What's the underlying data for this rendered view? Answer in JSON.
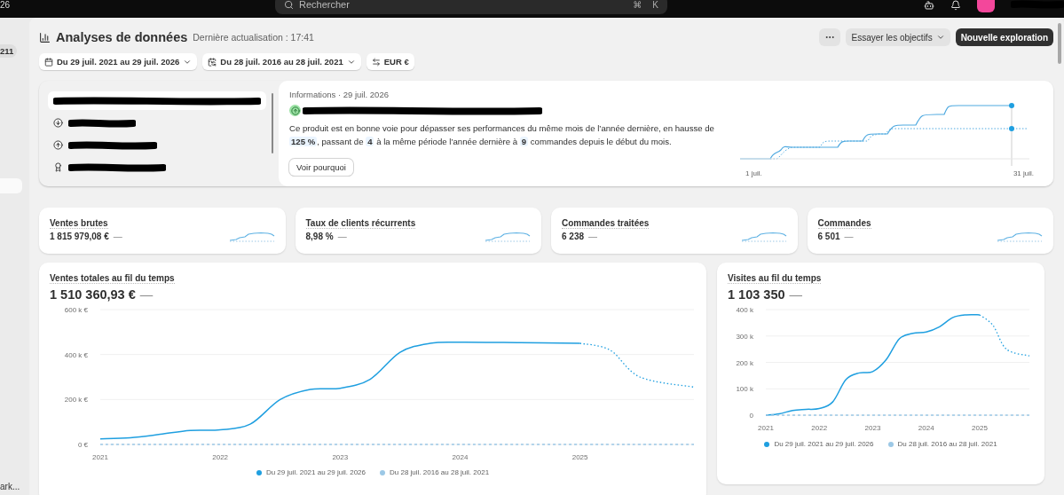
{
  "top_bar": {
    "corner_text": "26",
    "search": {
      "placeholder": "Rechercher",
      "shortcut": [
        "⌘",
        "K"
      ]
    }
  },
  "sidebar": {
    "badge": "211",
    "items": [
      {
        "selected": true
      }
    ],
    "footer_text": "ark..."
  },
  "header": {
    "title": "Analyses de données",
    "subtitle": "Dernière actualisation : 17:41",
    "actions": [
      {
        "kind": "more"
      },
      {
        "kind": "dropdown",
        "label": "Essayer les objectifs"
      },
      {
        "kind": "primary",
        "label": "Nouvelle exploration"
      }
    ]
  },
  "filters": [
    {
      "kind": "date",
      "label": "Du 29 juil. 2021 au 29 juil. 2026"
    },
    {
      "kind": "compare",
      "label": "Du 28 juil. 2016 au 28 juil. 2021"
    },
    {
      "kind": "currency",
      "label": "EUR €"
    }
  ],
  "insights": {
    "items": [
      {
        "kind": "covered",
        "selected": true
      },
      {
        "kind": "down",
        "selected": false
      },
      {
        "kind": "up",
        "selected": false
      },
      {
        "kind": "award",
        "selected": false
      }
    ],
    "detail": {
      "heading": "Informations · 29 juil. 2026",
      "text": "Ce produit est en bonne voie pour dépasser ses performances du même mois de l’année dernière, en hausse de **125 %**, passant de **4** à la même période l’année dernière à **9** commandes depuis le début du mois.",
      "button": "Voir pourquoi",
      "chart_labels": [
        "1 juil.",
        "31 juil."
      ]
    }
  },
  "kpis": [
    {
      "label": "Ventes brutes",
      "value": "1 815 979,08 €",
      "change": "—"
    },
    {
      "label": "Taux de clients récurrents",
      "value": "8,98 %",
      "change": "—"
    },
    {
      "label": "Commandes traitées",
      "value": "6 238",
      "change": "—"
    },
    {
      "label": "Commandes",
      "value": "6 501",
      "change": "—"
    }
  ],
  "charts": [
    {
      "title": "Ventes totales au fil du temps",
      "value": "1 510 360,93 €",
      "change": "—",
      "chart_data": {
        "type": "line",
        "x": [
          2021,
          2021.25,
          2021.5,
          2021.75,
          2022,
          2022.25,
          2022.5,
          2022.75,
          2023,
          2023.25,
          2023.5,
          2023.75,
          2024,
          2024.5,
          2025,
          2025.25,
          2025.5,
          2025.95
        ],
        "xlim": [
          2021,
          2025.95
        ],
        "ylim": [
          0,
          600000
        ],
        "xticks": [
          2021,
          2022,
          2023,
          2024,
          2025
        ],
        "yticks": [
          {
            "value": 0,
            "label": "0 €"
          },
          {
            "value": 200000,
            "label": "200 k €"
          },
          {
            "value": 400000,
            "label": "400 k €"
          },
          {
            "value": 600000,
            "label": "600 k €"
          }
        ],
        "grid": true,
        "series": [
          {
            "name": "Du 29 juil. 2021 au 29 juil. 2026",
            "color": "#1f9fe0",
            "line_style": "solid",
            "values": [
              25000,
              30000,
              45000,
              62000,
              65000,
              90000,
              200000,
              245000,
              250000,
              290000,
              410000,
              450000,
              455000,
              453000,
              450000,
              null,
              null,
              null
            ]
          },
          {
            "color": "#1f9fe0",
            "line_style": "dotted",
            "values": [
              null,
              null,
              null,
              null,
              null,
              null,
              null,
              null,
              null,
              null,
              null,
              null,
              null,
              null,
              450000,
              420000,
              300000,
              255000
            ]
          },
          {
            "name": "Du 28 juil. 2016 au 28 juil. 2021",
            "color": "#9cc8e6",
            "line_style": "dashed",
            "values": [
              0,
              0,
              0,
              0,
              0,
              0,
              0,
              0,
              0,
              0,
              0,
              0,
              0,
              0,
              0,
              0,
              0,
              0
            ]
          }
        ]
      }
    },
    {
      "title": "Visites au fil du temps",
      "value": "1 103 350",
      "change": "—",
      "chart_data": {
        "type": "line",
        "x": [
          2021,
          2021.25,
          2021.5,
          2021.75,
          2022,
          2022.25,
          2022.5,
          2022.75,
          2023,
          2023.25,
          2023.5,
          2023.75,
          2024,
          2024.25,
          2024.5,
          2024.75,
          2025,
          2025.25,
          2025.5,
          2025.93
        ],
        "xlim": [
          2021,
          2025.93
        ],
        "ylim": [
          0,
          400000
        ],
        "xticks": [
          2021,
          2022,
          2023,
          2024,
          2025
        ],
        "yticks": [
          {
            "value": 0,
            "label": "0"
          },
          {
            "value": 100000,
            "label": "100 k"
          },
          {
            "value": 200000,
            "label": "200 k"
          },
          {
            "value": 300000,
            "label": "300 k"
          },
          {
            "value": 400000,
            "label": "400 k"
          }
        ],
        "grid": true,
        "series": [
          {
            "name": "Du 29 juil. 2021 au 29 juil. 2026",
            "color": "#1f9fe0",
            "line_style": "solid",
            "values": [
              0,
              5000,
              18000,
              22000,
              25000,
              50000,
              135000,
              160000,
              165000,
              210000,
              290000,
              310000,
              315000,
              335000,
              370000,
              380000,
              380000,
              null,
              null,
              null
            ]
          },
          {
            "color": "#1f9fe0",
            "line_style": "dotted",
            "values": [
              null,
              null,
              null,
              null,
              null,
              null,
              null,
              null,
              null,
              null,
              null,
              null,
              null,
              null,
              null,
              null,
              380000,
              340000,
              250000,
              225000
            ]
          },
          {
            "name": "Du 28 juil. 2016 au 28 juil. 2021",
            "color": "#9cc8e6",
            "line_style": "dashed",
            "values": [
              0,
              0,
              0,
              0,
              0,
              0,
              0,
              0,
              0,
              0,
              0,
              0,
              0,
              0,
              0,
              0,
              0,
              0,
              0,
              0
            ]
          }
        ]
      }
    }
  ]
}
